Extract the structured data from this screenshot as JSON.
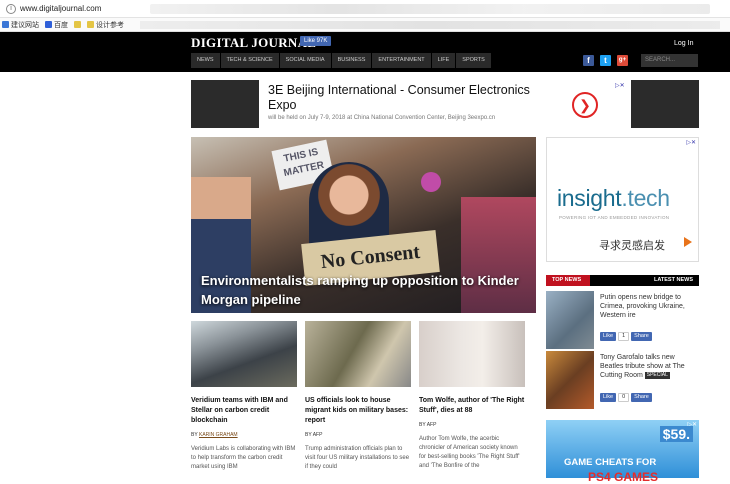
{
  "browser": {
    "url": "www.digitaljournal.com",
    "bookmarks": [
      {
        "label": "建议网站",
        "color": "#3a76d6"
      },
      {
        "label": "百度",
        "color": "#2f5fd8"
      },
      {
        "label": "",
        "color": "#e4c545"
      },
      {
        "label": "设计参考",
        "color": "#e4c545"
      }
    ]
  },
  "header": {
    "logo": "DIGITAL JOURNAL",
    "like_label": "Like 97K",
    "login": "Log In",
    "nav": [
      "NEWS",
      "TECH & SCIENCE",
      "SOCIAL MEDIA",
      "BUSINESS",
      "ENTERTAINMENT",
      "LIFE",
      "SPORTS"
    ],
    "search_placeholder": "SEARCH...",
    "social_icons": [
      "facebook-icon",
      "twitter-icon",
      "google-plus-icon"
    ],
    "social_glyphs": {
      "facebook": "f",
      "twitter": "t",
      "google": "g+"
    },
    "colors": {
      "facebook": "#3b5998",
      "twitter": "#1da1f2",
      "google": "#dd4b39"
    }
  },
  "top_ad": {
    "title": "3E Beijing International - Consumer Electronics Expo",
    "subtitle": "will be held on July 7-9, 2018 at China National Convention Center, Beijing  3eexpo.cn",
    "arrow": "❯"
  },
  "hero": {
    "caption": "Environmentalists ramping up opposition to Kinder Morgan pipeline",
    "sign_text": "No Consent",
    "sign2_text": "THIS IS MATTER"
  },
  "side_ad": {
    "brand_main": "insight",
    "brand_tld": ".tech",
    "tagline": "POWERING IOT AND EMBEDDED INNOVATION",
    "cta": "寻求灵感启发"
  },
  "top_news": {
    "label_left": "TOP NEWS",
    "label_right": "LATEST NEWS",
    "items": [
      {
        "text": "Putin opens new bridge to Crimea, provoking Ukraine, Western ire",
        "like": "Like",
        "count": "1",
        "share": "Share",
        "special": ""
      },
      {
        "text": "Tony Garofalo talks new Beatles tribute show at The Cutting Room",
        "like": "Like",
        "count": "0",
        "share": "Share",
        "special": "SPECIAL"
      }
    ]
  },
  "game_ad": {
    "price": "$59.",
    "line1": "GAME CHEATS FOR",
    "line2": "PS4 GAMES"
  },
  "stories": [
    {
      "headline": "Veridium teams with IBM and Stellar on carbon credit blockchain",
      "by_prefix": "BY",
      "author": "KARIN GRAHAM",
      "desc": "Veridium Labs is collaborating with IBM to help transform the carbon credit market using IBM"
    },
    {
      "headline": "US officials look to house migrant kids on military bases: report",
      "by_prefix": "BY",
      "author": "AFP",
      "desc": "Trump administration officials plan to visit four US military installations to see if they could"
    },
    {
      "headline": "Tom Wolfe, author of 'The Right Stuff', dies at 88",
      "by_prefix": "BY",
      "author": "AFP",
      "desc": "Author Tom Wolfe, the acerbic chronicler of American society known for best-selling books 'The Right Stuff' and 'The Bonfire of the"
    }
  ]
}
